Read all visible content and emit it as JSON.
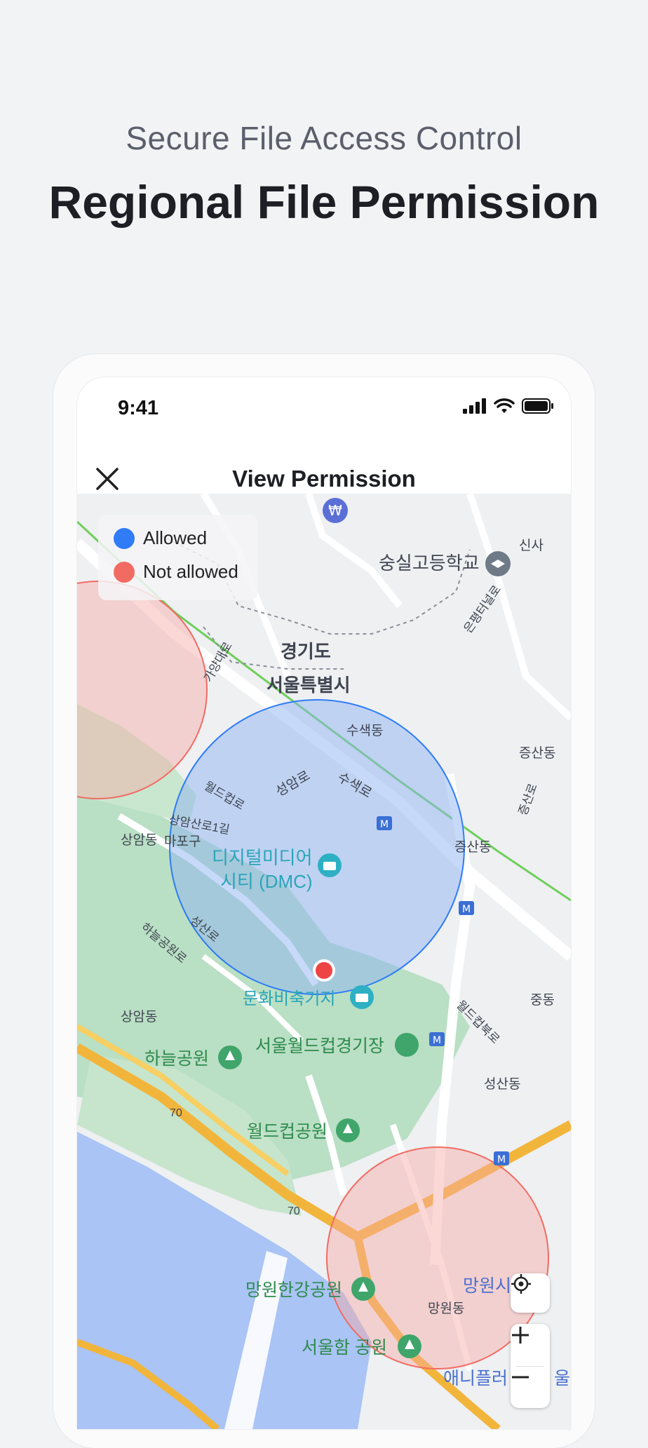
{
  "header": {
    "subtitle": "Secure File Access Control",
    "title": "Regional File Permission"
  },
  "status_bar": {
    "time": "9:41"
  },
  "nav": {
    "title": "View Permission"
  },
  "legend": {
    "allowed_label": "Allowed",
    "not_allowed_label": "Not allowed",
    "allowed_color": "#2f7cf6",
    "not_allowed_color": "#f26b63"
  },
  "map": {
    "labels": {
      "gyeonggi": "경기도",
      "seoul": "서울특별시",
      "school": "숭실고등학교",
      "susaek_dong": "수색동",
      "susaek_ro": "수색로",
      "seongam_ro": "성암로",
      "dmc_line1": "디지털미디어",
      "dmc_line2": "시티 (DMC)",
      "jeungsan_dong": "증산동",
      "jeungsan_dong2": "증산동",
      "sangam_dong": "상암동",
      "mapo_gu": "마포구",
      "sangam_dong2": "상암동",
      "culture_depot": "문화비축기지",
      "haneul_park": "하늘공원",
      "worldcup_stadium": "서울월드컵경기장",
      "worldcup_park": "월드컵공원",
      "mangwon_hangang": "망원한강공원",
      "mangwon_dong": "망원동",
      "seoulham_park": "서울함 공원",
      "seongsan_dong": "성산동",
      "jung_dong": "중동",
      "mangwon_partial": "망원시",
      "animal_partial": "애니플러",
      "sinsa_partial": "신사",
      "road_70a": "70",
      "road_70b": "70",
      "worldcup_bukro": "월드컵북로",
      "jeungsan_ro": "증산로",
      "eunpyeong_ro": "은평터널로",
      "gayang_ro": "가양대로",
      "sangam_san_ro": "상암산로1길",
      "haneul_ro": "하늘공원로",
      "worldcup_ro": "월드컵로",
      "seongsan_ro": "성산로",
      "ul": "울"
    }
  }
}
